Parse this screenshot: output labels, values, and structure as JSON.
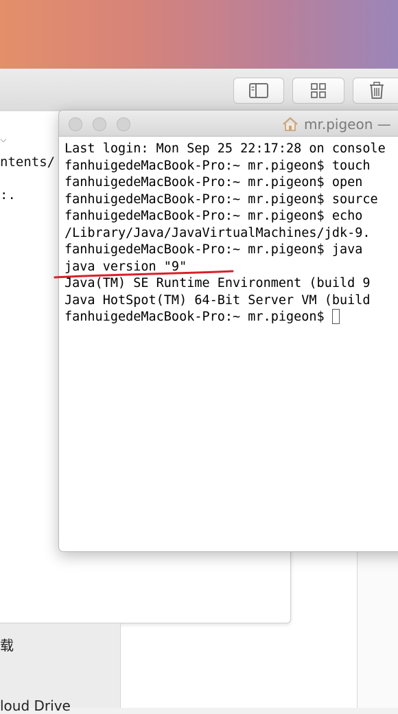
{
  "finder": {
    "path_fragment": "ntents/",
    "colon_text": ":.",
    "chevron": "⌵",
    "sidebar": [
      {
        "label": "载"
      },
      {
        "label": "loud Drive"
      }
    ]
  },
  "toolbar": {
    "icons": [
      "sidebar-toggle-icon",
      "grid-view-icon",
      "trash-icon"
    ]
  },
  "terminal": {
    "title": "mr.pigeon —",
    "lines": [
      "Last login: Mon Sep 25 22:17:28 on console",
      "fanhuigedeMacBook-Pro:~ mr.pigeon$ touch",
      "fanhuigedeMacBook-Pro:~ mr.pigeon$ open ",
      "fanhuigedeMacBook-Pro:~ mr.pigeon$ source",
      "fanhuigedeMacBook-Pro:~ mr.pigeon$ echo ",
      "/Library/Java/JavaVirtualMachines/jdk-9.",
      "fanhuigedeMacBook-Pro:~ mr.pigeon$ java ",
      "java version \"9\"",
      "Java(TM) SE Runtime Environment (build 9",
      "Java HotSpot(TM) 64-Bit Server VM (build",
      "fanhuigedeMacBook-Pro:~ mr.pigeon$ "
    ]
  },
  "annotation": {
    "color": "#d8202a"
  }
}
